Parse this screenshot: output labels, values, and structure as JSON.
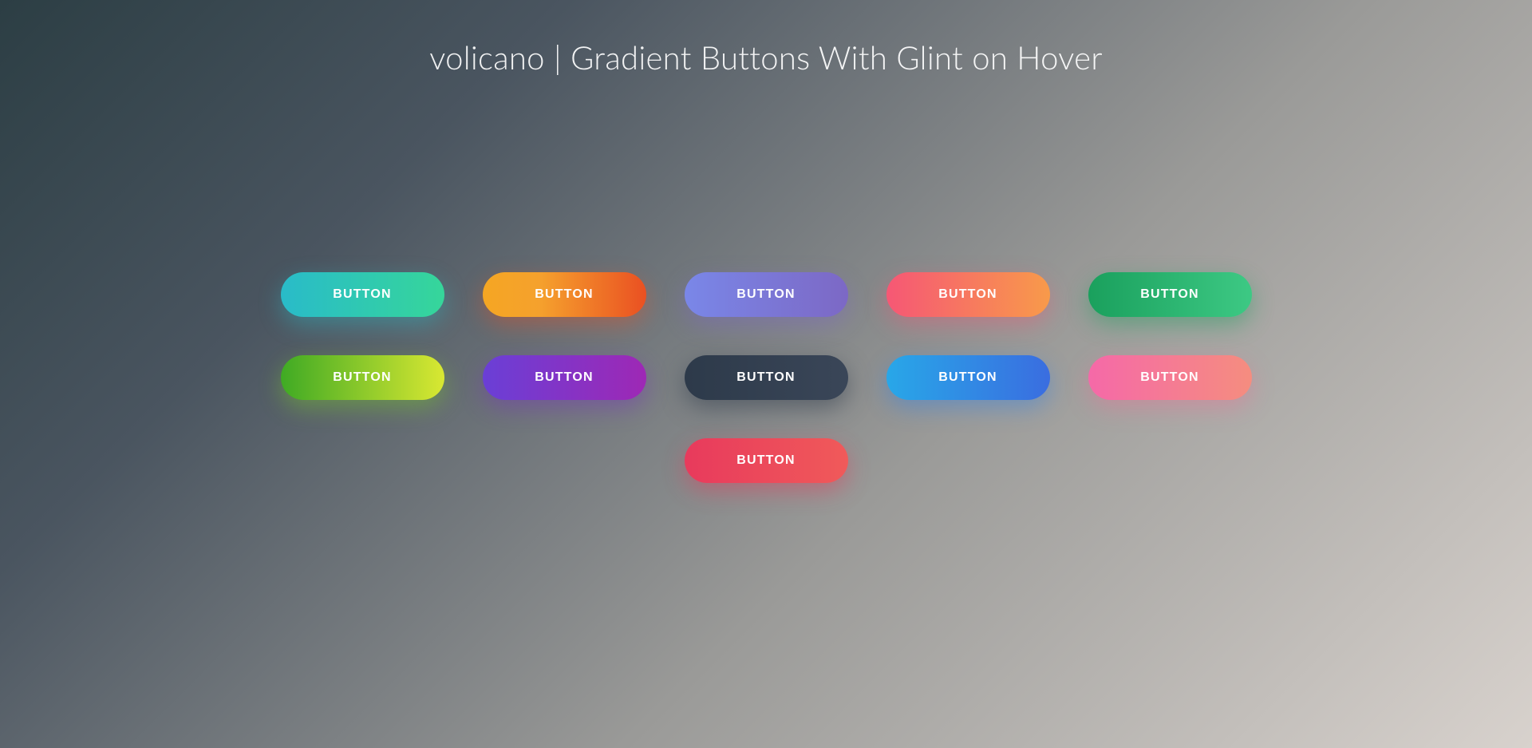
{
  "title": "volicano | Gradient Buttons With Glint on Hover",
  "buttons": [
    {
      "label": "BUTTON",
      "style": "btn-1"
    },
    {
      "label": "BUTTON",
      "style": "btn-2"
    },
    {
      "label": "BUTTON",
      "style": "btn-3"
    },
    {
      "label": "BUTTON",
      "style": "btn-4"
    },
    {
      "label": "BUTTON",
      "style": "btn-5"
    },
    {
      "label": "BUTTON",
      "style": "btn-6"
    },
    {
      "label": "BUTTON",
      "style": "btn-7"
    },
    {
      "label": "BUTTON",
      "style": "btn-8"
    },
    {
      "label": "BUTTON",
      "style": "btn-9"
    },
    {
      "label": "BUTTON",
      "style": "btn-10"
    },
    {
      "label": "BUTTON",
      "style": "btn-11"
    }
  ]
}
